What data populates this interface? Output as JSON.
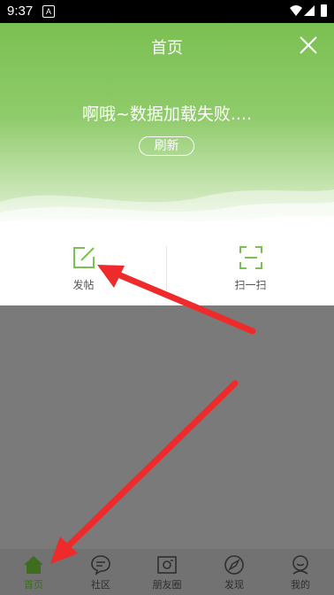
{
  "status_bar": {
    "time": "9:37",
    "notification": "A"
  },
  "header": {
    "title": "首页"
  },
  "hero": {
    "error_message": "啊哦~数据加载失败....",
    "refresh_label": "刷新"
  },
  "actions": [
    {
      "label": "发帖",
      "icon": "edit-icon"
    },
    {
      "label": "扫一扫",
      "icon": "scan-icon"
    }
  ],
  "tabs": [
    {
      "label": "首页",
      "icon": "home-icon",
      "active": true
    },
    {
      "label": "社区",
      "icon": "chat-bubble-icon",
      "active": false
    },
    {
      "label": "朋友圈",
      "icon": "camera-icon",
      "active": false
    },
    {
      "label": "发现",
      "icon": "compass-icon",
      "active": false
    },
    {
      "label": "我的",
      "icon": "user-icon",
      "active": false
    }
  ],
  "colors": {
    "brand_green": "#7bc052",
    "arrow_red": "#ee2a2a",
    "active_tab": "#3e6d1f",
    "overlay_gray": "#7a7a7a"
  }
}
